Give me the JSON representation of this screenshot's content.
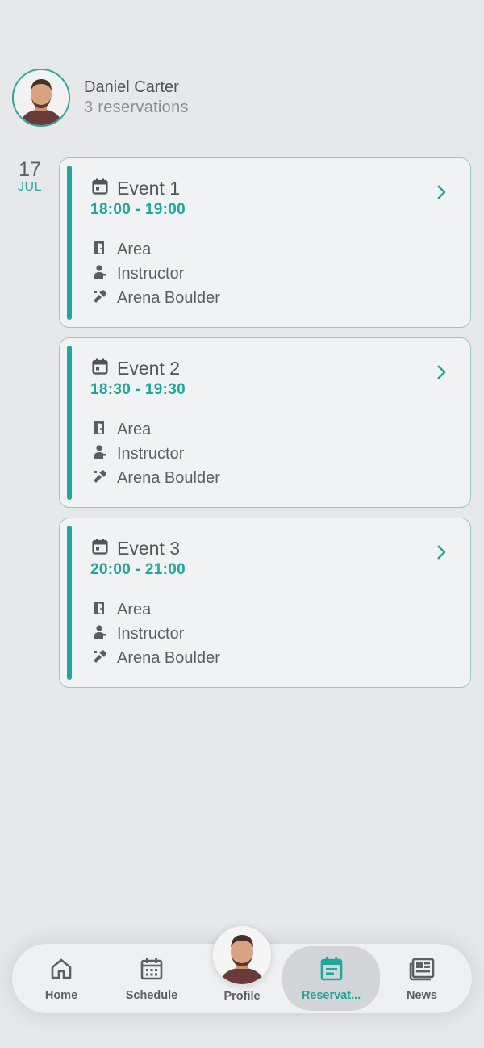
{
  "user": {
    "name": "Daniel Carter",
    "reservations_text": "3 reservations"
  },
  "date": {
    "day": "17",
    "month": "JUL"
  },
  "events": [
    {
      "title": "Event 1",
      "time": "18:00 - 19:00",
      "area": "Area",
      "instructor": "Instructor",
      "location": "Arena Boulder"
    },
    {
      "title": "Event 2",
      "time": "18:30 - 19:30",
      "area": "Area",
      "instructor": "Instructor",
      "location": "Arena Boulder"
    },
    {
      "title": "Event 3",
      "time": "20:00 - 21:00",
      "area": "Area",
      "instructor": "Instructor",
      "location": "Arena Boulder"
    }
  ],
  "nav": {
    "home": "Home",
    "schedule": "Schedule",
    "profile": "Profile",
    "reservations": "Reservat...",
    "news": "News"
  },
  "colors": {
    "accent": "#1ea89b",
    "background": "#e7e8ea",
    "card": "#f1f2f4",
    "text": "#555a5f"
  }
}
